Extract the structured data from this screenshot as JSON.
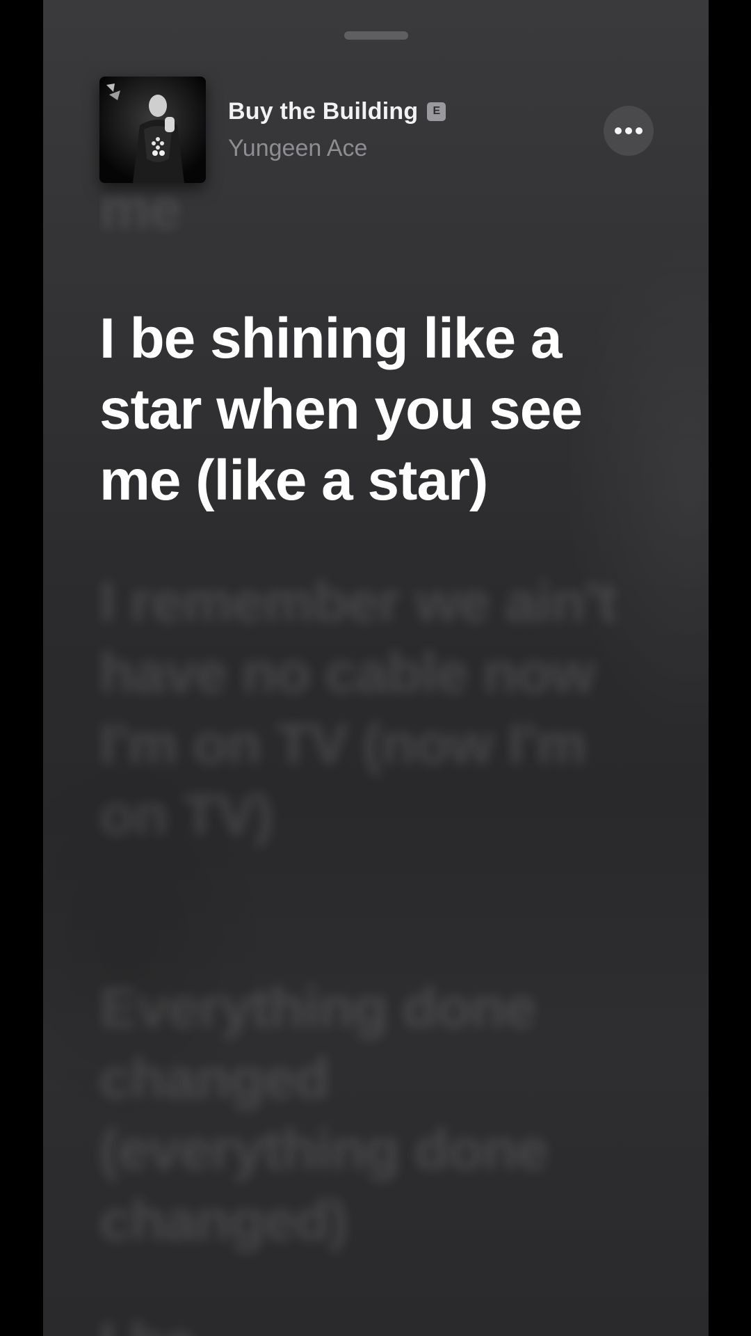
{
  "now_playing": {
    "title": "Buy the Building",
    "explicit_badge": "E",
    "artist": "Yungeen Ace",
    "artwork_icon": "album-artwork",
    "more_icon": "ellipsis-icon"
  },
  "lyrics": {
    "previous_line": "me",
    "current_line": "I be shining like a star when you see me (like a star)",
    "next_lines": [
      "I remember we ain't have no cable now I'm on TV (now I'm on TV)",
      "Everything done changed (everything done changed)",
      "I be"
    ]
  },
  "colors": {
    "background": "#2b2b2d",
    "active_lyric": "#ffffff",
    "artist_text": "#8e8e92",
    "title_text": "#f2f2f4"
  }
}
